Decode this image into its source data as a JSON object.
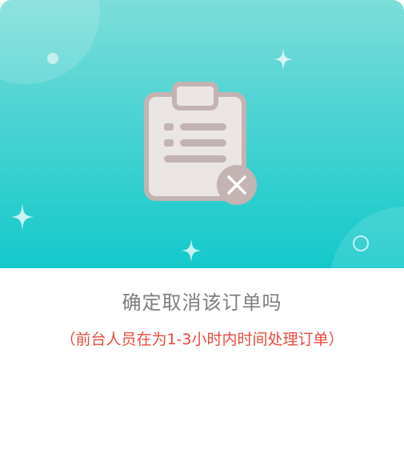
{
  "dialog": {
    "title": "确定取消该订单吗",
    "subtitle": "（前台人员在为1-3小时内时间处理订单）"
  },
  "illustration": {
    "icon": "clipboard-cancel-icon"
  },
  "colors": {
    "header_top": "#7dddd9",
    "header_bottom": "#14c9cb",
    "title": "#7f7f7f",
    "subtitle": "#e84b3c",
    "clipboard": "#c3b3b2"
  }
}
